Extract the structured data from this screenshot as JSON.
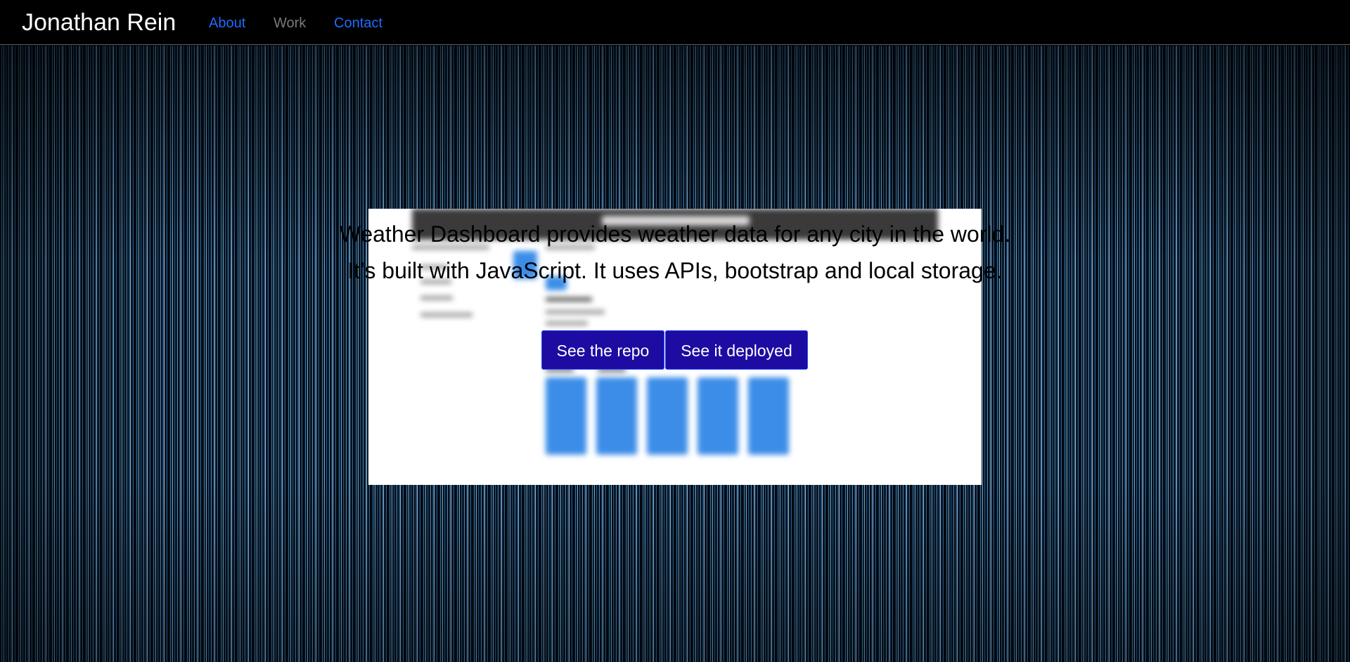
{
  "nav": {
    "brand": "Jonathan Rein",
    "links": [
      {
        "label": "About",
        "color": "#1f6cff"
      },
      {
        "label": "Work",
        "color": "#7a7a7a"
      },
      {
        "label": "Contact",
        "color": "#1f6cff"
      }
    ]
  },
  "project": {
    "description_line1": "Weather Dashboard provides weather data for any city in the world.",
    "description_line2": "It's built with JavaScript. It uses APIs, bootstrap and local storage.",
    "buttons": {
      "repo_label": "See the repo",
      "deployed_label": "See it deployed"
    }
  },
  "colors": {
    "navbar_bg": "#000000",
    "button_bg": "#1d0ca1",
    "link_active": "#1f6cff",
    "link_current": "#7a7a7a",
    "screenshot_accent": "#3b8de8"
  }
}
